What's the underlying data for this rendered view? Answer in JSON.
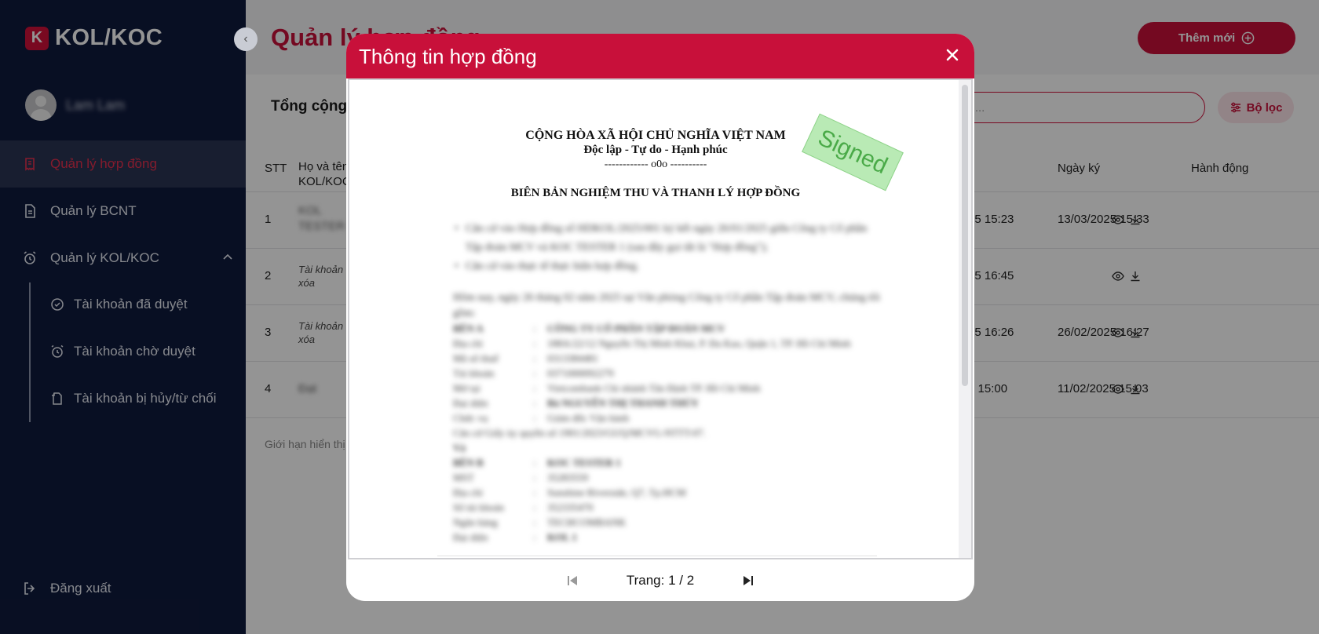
{
  "sidebar": {
    "logo_mark": "K",
    "logo_text": "KOL/KOC",
    "user_name": "Lam Lam",
    "items": [
      {
        "label": "Quản lý hợp đồng"
      },
      {
        "label": "Quản lý BCNT"
      },
      {
        "label": "Quản lý KOL/KOC"
      }
    ],
    "subitems": [
      {
        "label": "Tài khoản đã duyệt"
      },
      {
        "label": "Tài khoản chờ duyệt"
      },
      {
        "label": "Tài khoản bị hủy/từ chối"
      }
    ],
    "logout_label": "Đăng xuất"
  },
  "header": {
    "title": "Quản lý hợp đồng",
    "add_label": "Thêm mới"
  },
  "toolbar": {
    "total_label": "Tổng cộng",
    "search_placeholder": "Tìm kiếm ...",
    "filter_label": "Bộ lọc"
  },
  "table": {
    "columns": [
      "STT",
      "Họ và tên KOL/KOC",
      "Ngày ký",
      "Hành động"
    ],
    "rows": [
      {
        "stt": "1",
        "name": "KOL TESTER",
        "name_note": "",
        "created": "25 15:23",
        "signed": "13/03/2025 15:33"
      },
      {
        "stt": "2",
        "name": "",
        "name_note": "Tài khoản xóa",
        "created": "25 16:45",
        "signed": ""
      },
      {
        "stt": "3",
        "name": "",
        "name_note": "Tài khoản xóa",
        "created": "25 16:26",
        "signed": "26/02/2025 16:27"
      },
      {
        "stt": "4",
        "name": "Đạt",
        "name_note": "",
        "created": "5 15:00",
        "signed": "11/02/2025 15:03"
      }
    ],
    "limit_text": "Giới hạn hiển thị"
  },
  "modal": {
    "title": "Thông tin hợp đồng",
    "doc": {
      "line1": "CỘNG HÒA XÃ HỘI CHỦ NGHĨA VIỆT NAM",
      "line2": "Độc lập - Tự do - Hạnh phúc",
      "line3": "------------ o0o ----------",
      "title": "BIÊN BẢN NGHIỆM THU VÀ THANH LÝ HỢP ĐỒNG",
      "stamp": "Signed",
      "bullet1": "Căn cứ vào Hợp đồng số HDKOL/2025/001 ký kết ngày 26/01/2025 giữa Công ty Cổ phần Tập đoàn MCV và KOC TESTER 1 (sau đây gọi tắt là \"Hợp đồng\");",
      "bullet2": "Căn cứ vào thực tế thực hiện hợp đồng.",
      "intro": "Hôm nay, ngày 26 tháng 02 năm 2025 tại Văn phòng Công ty Cổ phần Tập đoàn MCV, chúng tôi gồm:",
      "party_a": [
        {
          "k": "BÊN A",
          "v": "CÔNG TY CỔ PHẦN TẬP ĐOÀN MCV"
        },
        {
          "k": "Địa chỉ",
          "v": "188A/22/12 Nguyễn Thị Minh Khai, P. Đa Kao, Quận 1, TP. Hồ Chí Minh"
        },
        {
          "k": "Mã số thuế",
          "v": "0313384481"
        },
        {
          "k": "Tài khoản",
          "v": "0371000092279"
        },
        {
          "k": "Mở tại",
          "v": "Vietcombank Chi nhánh Tân Định TP. Hồ Chí Minh"
        },
        {
          "k": "Đại diện",
          "v": "Bà NGUYỄN THỊ THANH THÚY"
        },
        {
          "k": "Chức vụ",
          "v": "Giám đốc Vận hành"
        }
      ],
      "auth_line": "Căn cứ Giấy ủy quyền số 1901/2023/GUQ/MCVG-NTTT-07.",
      "and": "Và",
      "party_b": [
        {
          "k": "BÊN B",
          "v": "KOC TESTER 1"
        },
        {
          "k": "MST",
          "v": "35283559"
        },
        {
          "k": "Địa chỉ",
          "v": "Sunshine Riverside, Q7, Tp.HCM"
        },
        {
          "k": "Số tài khoản",
          "v": "352335470"
        },
        {
          "k": "Ngân hàng",
          "v": "TECHCOMBANK"
        },
        {
          "k": "Đại diện",
          "v": "KOL 1"
        }
      ]
    },
    "pager_text": "Trang: 1 / 2"
  },
  "colors": {
    "brand": "#c8103a",
    "sidebar": "#0f1a3d",
    "stamp": "#b9eab5"
  }
}
